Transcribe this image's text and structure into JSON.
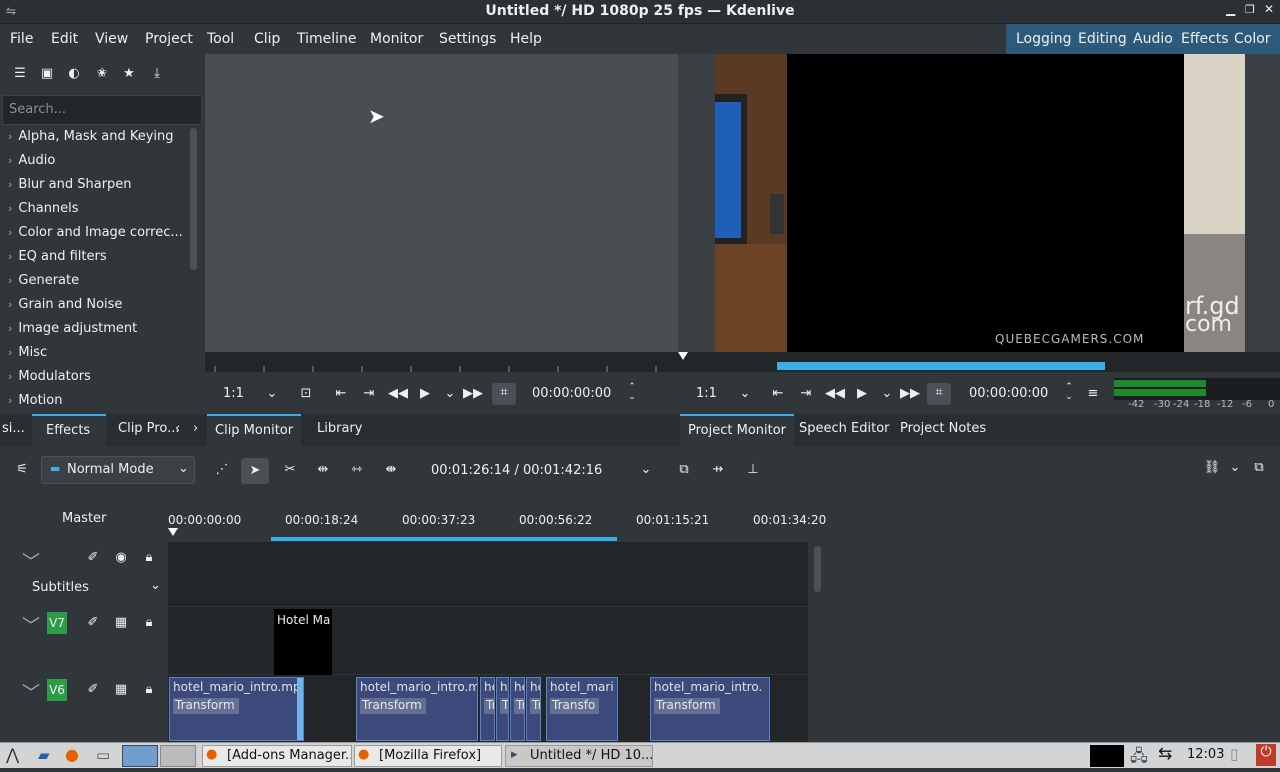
{
  "window": {
    "title": "Untitled */ HD 1080p 25 fps — Kdenlive"
  },
  "menu": [
    "File",
    "Edit",
    "View",
    "Project",
    "Tool",
    "Clip",
    "Timeline",
    "Monitor",
    "Settings",
    "Help"
  ],
  "workspaces": [
    "Logging",
    "Editing",
    "Audio",
    "Effects",
    "Color"
  ],
  "effects": {
    "search_placeholder": "Search...",
    "categories": [
      "Alpha, Mask and Keying",
      "Audio",
      "Blur and Sharpen",
      "Channels",
      "Color and Image correc...",
      "EQ and filters",
      "Generate",
      "Grain and Noise",
      "Image adjustment",
      "Misc",
      "Modulators",
      "Motion"
    ]
  },
  "left_tabs": [
    "si...",
    "Effects",
    "Clip Pro..."
  ],
  "clip_monitor": {
    "zoom": "1:1",
    "timecode": "00:00:00:00",
    "tabs": [
      "Clip Monitor",
      "Library"
    ]
  },
  "project_monitor": {
    "zoom": "1:1",
    "timecode": "00:00:00:00",
    "tabs": [
      "Project Monitor",
      "Speech Editor",
      "Project Notes"
    ],
    "vu_labels": [
      "-42",
      "-30",
      "-24",
      "-18",
      "-12",
      "-6",
      "0"
    ],
    "video_watermark_a": "rf.gd",
    "video_watermark_b": "com",
    "video_watermark_c": "QUEBECGAMERS.COM"
  },
  "timeline": {
    "edit_mode": "Normal Mode",
    "position": "00:01:26:14 / 00:01:42:16",
    "master_label": "Master",
    "ruler": [
      "00:00:00:00",
      "00:00:18:24",
      "00:00:37:23",
      "00:00:56:22",
      "00:01:15:21",
      "00:01:34:20"
    ],
    "subtitles_label": "Subtitles",
    "tracks": [
      "V7",
      "V6"
    ],
    "title_clip": "Hotel Ma",
    "clips": [
      {
        "name": "hotel_mario_intro.mp",
        "fx": "Transform"
      },
      {
        "name": "hotel_mario_intro.m",
        "fx": "Transform"
      },
      {
        "name": "he",
        "fx": "Tr"
      },
      {
        "name": "h",
        "fx": "Tr"
      },
      {
        "name": "he",
        "fx": "Tr"
      },
      {
        "name": "he",
        "fx": "Tr"
      },
      {
        "name": "hotel_mari",
        "fx": "Transfo"
      },
      {
        "name": "hotel_mario_intro.",
        "fx": "Transform"
      }
    ]
  },
  "taskbar": {
    "tasks": [
      "[Add-ons Manager...",
      "[Mozilla Firefox]",
      "Untitled */ HD 10..."
    ],
    "clock": "12:03"
  }
}
